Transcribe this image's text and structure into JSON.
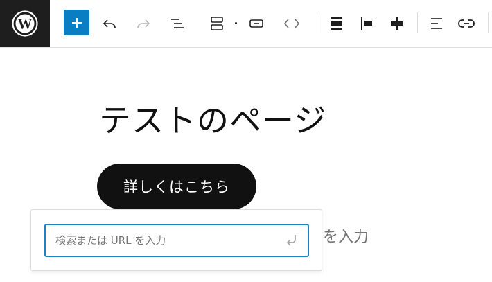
{
  "toolbar": {
    "buttons": [
      {
        "name": "wordpress-logo",
        "icon": "wordpress-icon"
      },
      {
        "name": "add-block",
        "icon": "plus-icon"
      },
      {
        "name": "undo",
        "icon": "undo-icon"
      },
      {
        "name": "redo",
        "icon": "redo-icon",
        "disabled": true
      },
      {
        "name": "document-overview",
        "icon": "list-view-icon"
      },
      {
        "name": "block-parent",
        "icon": "buttons-block-icon"
      },
      {
        "name": "block-type",
        "icon": "button-block-icon"
      },
      {
        "name": "move",
        "icon": "code-brackets-icon"
      },
      {
        "name": "justification",
        "icon": "justify-space-between-icon"
      },
      {
        "name": "vertical-alignment",
        "icon": "align-left-bar-icon"
      },
      {
        "name": "align-center",
        "icon": "align-center-icon"
      },
      {
        "name": "text-align",
        "icon": "align-text-left-icon"
      },
      {
        "name": "link",
        "icon": "link-icon"
      }
    ]
  },
  "editor": {
    "page_title": "テストのページ",
    "button_text": "詳しくはこちら",
    "placeholder_tail": "を入力"
  },
  "link_popover": {
    "input_placeholder": "検索または URL を入力",
    "submit_icon": "enter-icon"
  },
  "colors": {
    "accent": "#0a7ec2",
    "input_focus_border": "#1b82c4",
    "logo_bg": "#1e1e1e"
  }
}
